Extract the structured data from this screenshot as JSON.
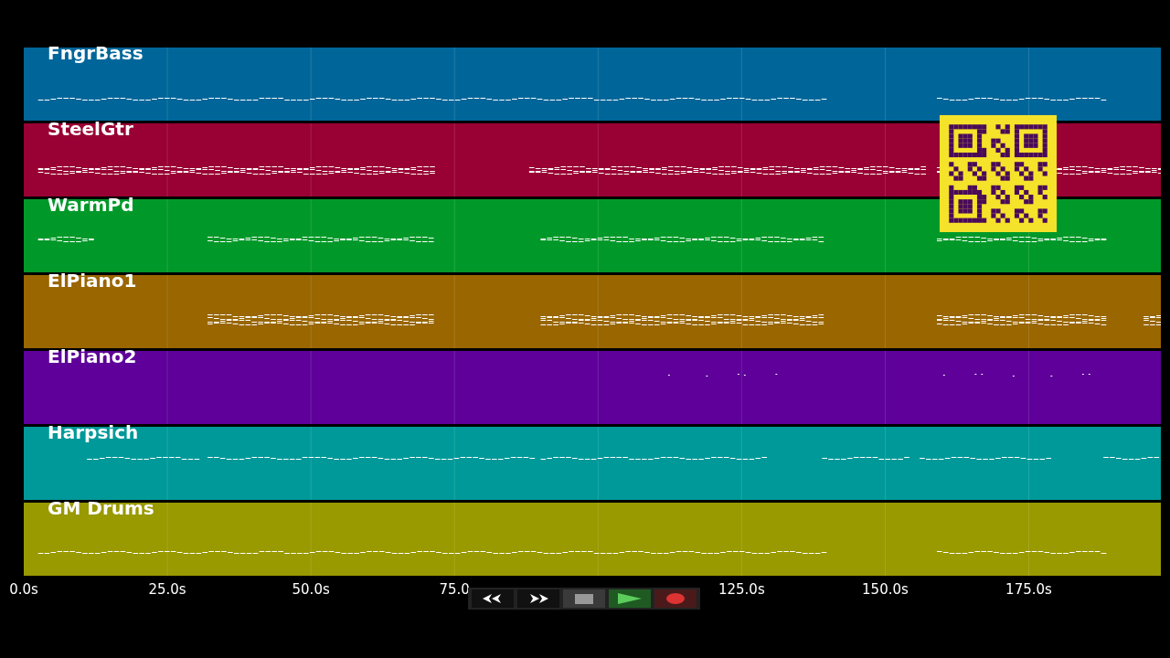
{
  "tracks": [
    {
      "name": "FngrBass",
      "color": "#006699"
    },
    {
      "name": "SteelGtr",
      "color": "#990033"
    },
    {
      "name": "WarmPd",
      "color": "#009929"
    },
    {
      "name": "ElPiano1",
      "color": "#996600"
    },
    {
      "name": "ElPiano2",
      "color": "#5e0099"
    },
    {
      "name": "Harpsich",
      "color": "#009999"
    },
    {
      "name": "GM Drums",
      "color": "#999900"
    }
  ],
  "time_axis": {
    "ticks_before_transport": [
      "0.0s",
      "25.0s",
      "50.0s",
      "75.0"
    ],
    "ticks_after_transport": [
      "125.0s",
      "150.0s",
      "175.0s"
    ]
  }
}
